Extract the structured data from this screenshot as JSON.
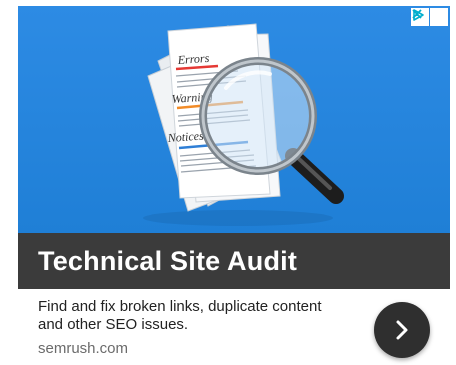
{
  "ad": {
    "image": {
      "doc_labels": [
        "Errors",
        "Warning",
        "Notices"
      ],
      "colors": {
        "errors": "#e53935",
        "warning": "#f28c28",
        "notices": "#2f7fd6"
      }
    },
    "adchoices": {
      "info_icon": "adchoices-triangle-icon",
      "close_icon": "close-icon"
    },
    "title": "Technical Site Audit",
    "description": "Find and fix broken links, duplicate content and other SEO issues.",
    "domain": "semrush.com",
    "cta_icon": "chevron-right-icon",
    "colors": {
      "hero_bg": "#2d8be4",
      "title_bar": "#3b3b3b",
      "cta_bg": "#2f2f2f",
      "adchoices": "#00aecd"
    }
  }
}
